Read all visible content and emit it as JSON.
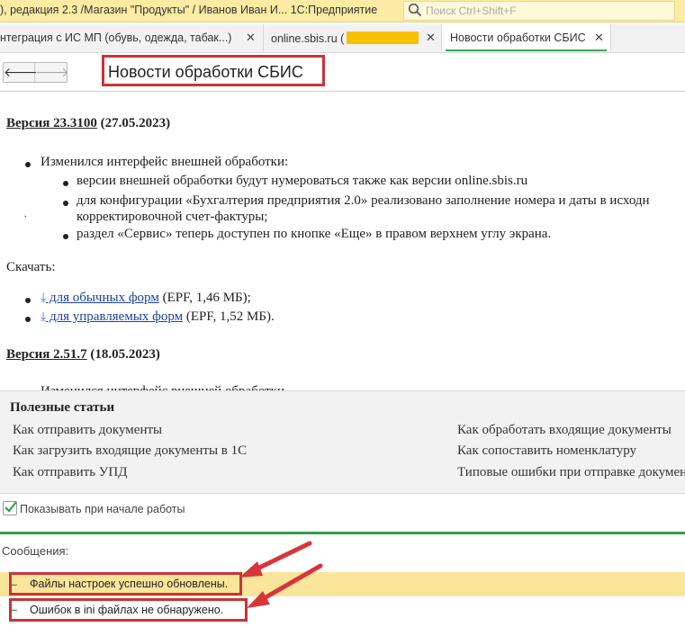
{
  "titlebar": {
    "title": "), редакция 2.3 /Магазин \"Продукты\" / Иванов Иван И...  1С:Предприятие",
    "search_placeholder": "Поиск Ctrl+Shift+F"
  },
  "tabs": [
    {
      "label": "нтеграция с ИС МП (обувь, одежда, табак...)"
    },
    {
      "label": "online.sbis.ru ("
    },
    {
      "label": "Новости обработки СБИС"
    }
  ],
  "page": {
    "title": "Новости обработки СБИС"
  },
  "news": {
    "v1": {
      "link": "Версия 23.3100",
      "date": " (27.05.2023)",
      "item": "Изменился интерфейс внешней обработки:",
      "sub1": "версии внешней обработки будут нумероваться также как версии online.sbis.ru",
      "sub2a": "для конфигурации «Бухгалтерия предприятия 2.0» реализовано заполнение номера и даты в исходн",
      "sub2b": "корректировочной счет-фактуры;",
      "sub3": "раздел «Сервис» теперь доступен по кнопке «Еще» в правом верхнем углу экрана."
    },
    "download_label": "Скачать:",
    "dl1": {
      "link": " для обычных форм",
      "info": " (EPF, 1,46 МБ);"
    },
    "dl2": {
      "link": " для управляемых форм",
      "info": " (EPF, 1,52 МБ)."
    },
    "v2": {
      "link": "Версия 2.51.7",
      "date": " (18.05.2023)"
    },
    "cut_text": "Изменился интерфейс внешней обработки"
  },
  "useful": {
    "title": "Полезные статьи",
    "links": [
      "Как отправить документы",
      "Как загрузить входящие документы в 1С",
      "Как отправить УПД",
      "Как обработать входящие документы",
      "Как сопоставить номенклатуру",
      "Типовые ошибки при отправке документов"
    ]
  },
  "show_at_start": {
    "label": "Показывать при начале работы",
    "checked": true
  },
  "messages": {
    "title": "Сообщения:",
    "items": [
      "Файлы настроек успешно обновлены.",
      "Ошибок в ini файлах не обнаружено."
    ]
  },
  "colors": {
    "accent_green": "#2f9e4f",
    "annotation_red": "#c8333a",
    "titlebar_yellow": "#fbeba3",
    "highlight_row": "#fbe59a",
    "link_blue": "#1b3f9a"
  }
}
